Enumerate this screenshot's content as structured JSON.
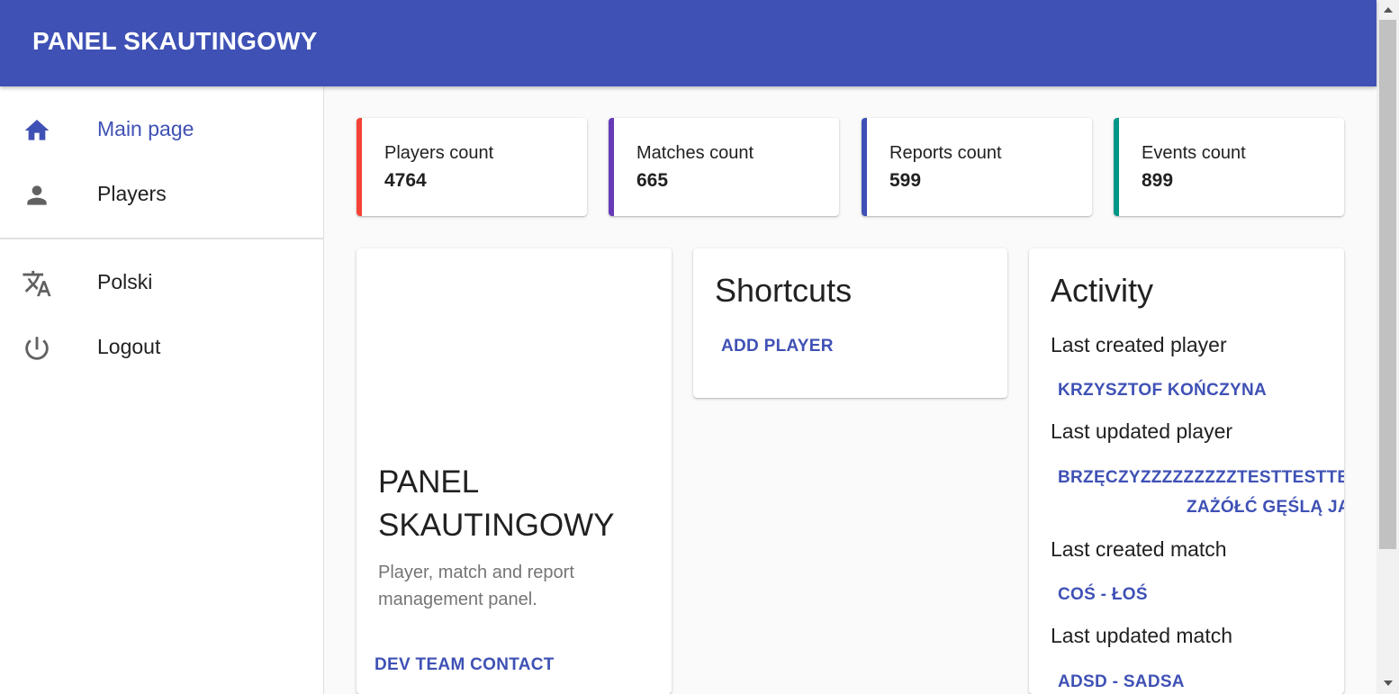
{
  "appbar": {
    "title": "PANEL SKAUTINGOWY"
  },
  "nav": {
    "items": [
      {
        "label": "Main page",
        "icon": "home-icon",
        "active": true
      },
      {
        "label": "Players",
        "icon": "person-icon",
        "active": false
      }
    ],
    "secondary": [
      {
        "label": "Polski",
        "icon": "translate-icon"
      },
      {
        "label": "Logout",
        "icon": "power-icon"
      }
    ]
  },
  "stats": [
    {
      "label": "Players count",
      "value": "4764",
      "color": "#f44336"
    },
    {
      "label": "Matches count",
      "value": "665",
      "color": "#673ab7"
    },
    {
      "label": "Reports count",
      "value": "599",
      "color": "#3f51b5"
    },
    {
      "label": "Events count",
      "value": "899",
      "color": "#009688"
    }
  ],
  "hero": {
    "title": "PANEL SKAUTINGOWY",
    "subtitle": "Player, match and report management panel.",
    "contact_label": "DEV TEAM CONTACT"
  },
  "shortcuts": {
    "title": "Shortcuts",
    "add_player_label": "ADD PLAYER"
  },
  "activity": {
    "title": "Activity",
    "last_created_player_label": "Last created player",
    "last_created_player": "KRZYSZTOF KOŃCZYNA",
    "last_updated_player_label": "Last updated player",
    "last_updated_player": "BRZĘCZYZZZZZZZZZTESTTESTTE",
    "last_updated_player_line2": "ZAŻÓŁĆ GĘŚLĄ JA",
    "last_created_match_label": "Last created match",
    "last_created_match": "COŚ - ŁOŚ",
    "last_updated_match_label": "Last updated match",
    "last_updated_match": "ADSD - SADSA"
  },
  "colors": {
    "primary": "#3f51b5",
    "icon_grey": "#616161"
  }
}
